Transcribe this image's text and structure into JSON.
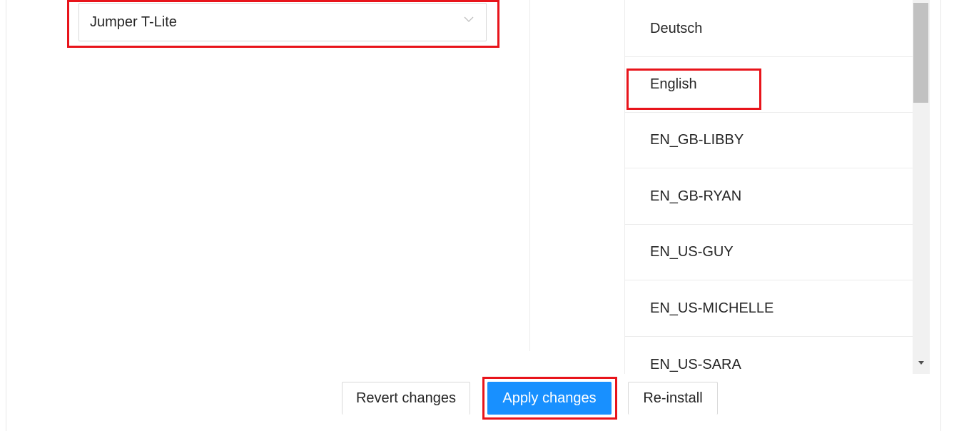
{
  "device_select": {
    "value": "Jumper T-Lite"
  },
  "languages": {
    "items": [
      {
        "label": "Deutsch"
      },
      {
        "label": "English"
      },
      {
        "label": "EN_GB-LIBBY"
      },
      {
        "label": "EN_GB-RYAN"
      },
      {
        "label": "EN_US-GUY"
      },
      {
        "label": "EN_US-MICHELLE"
      },
      {
        "label": "EN_US-SARA"
      }
    ]
  },
  "actions": {
    "revert_label": "Revert changes",
    "apply_label": "Apply changes",
    "reinstall_label": "Re-install"
  },
  "colors": {
    "accent": "#1890ff",
    "highlight": "#e8141b"
  }
}
